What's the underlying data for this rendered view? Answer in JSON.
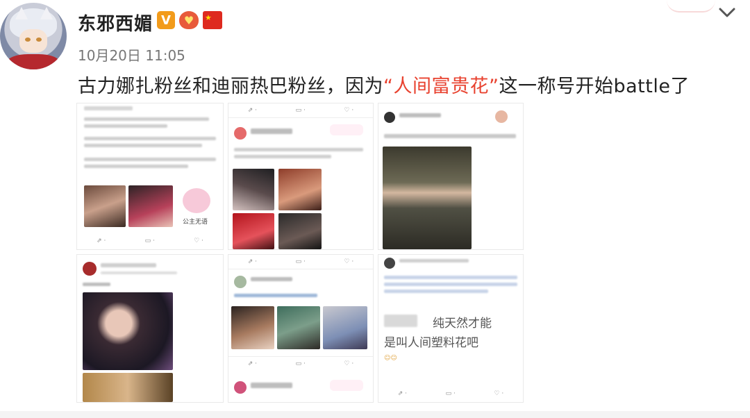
{
  "post": {
    "username": "东邪西媚",
    "badge_v": "V",
    "timestamp": "10月20日 11:05",
    "text_before": "古力娜扎粉丝和迪丽热巴粉丝，因为",
    "text_highlight": "“人间富贵花”",
    "text_after": "这一称号开始battle了",
    "highlight_color": "#e8422f"
  },
  "icons": [
    "chevron-down-icon",
    "verified-v-icon",
    "heart-badge-icon",
    "china-flag-icon"
  ],
  "thumbnails": {
    "sticker_princess": "公主无语",
    "card6_line1": "纯天然才能",
    "card6_line2": "是叫人间塑料花吧"
  }
}
